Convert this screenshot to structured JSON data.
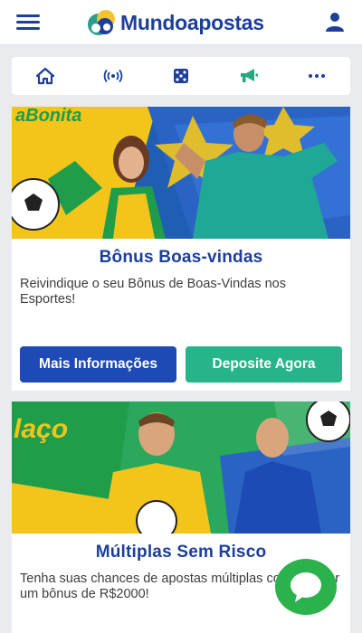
{
  "header": {
    "brand": "Mundoapostas",
    "icons": {
      "menu": "hamburger-menu-icon",
      "user": "user-profile-icon"
    }
  },
  "nav": {
    "items": [
      {
        "icon": "home-icon"
      },
      {
        "icon": "live-broadcast-icon"
      },
      {
        "icon": "dice-icon"
      },
      {
        "icon": "megaphone-icon"
      },
      {
        "icon": "more-dots-icon"
      }
    ]
  },
  "promotions": [
    {
      "banner_text": "aBonita",
      "title": "Bônus Boas-vindas",
      "description": "Reivindique o seu Bônus de Boas-Vindas nos Esportes!",
      "more_info_label": "Mais Informações",
      "deposit_label": "Deposite Agora"
    },
    {
      "banner_text": "laço",
      "title": "Múltiplas Sem Risco",
      "description": "Tenha suas chances de apostas múltiplas cobertas por um bônus de R$2000!"
    }
  ],
  "colors": {
    "brand_blue": "#1d3f9b",
    "button_blue": "#1d4ab5",
    "button_green": "#26b48b",
    "chat_green": "#2bb24c"
  }
}
